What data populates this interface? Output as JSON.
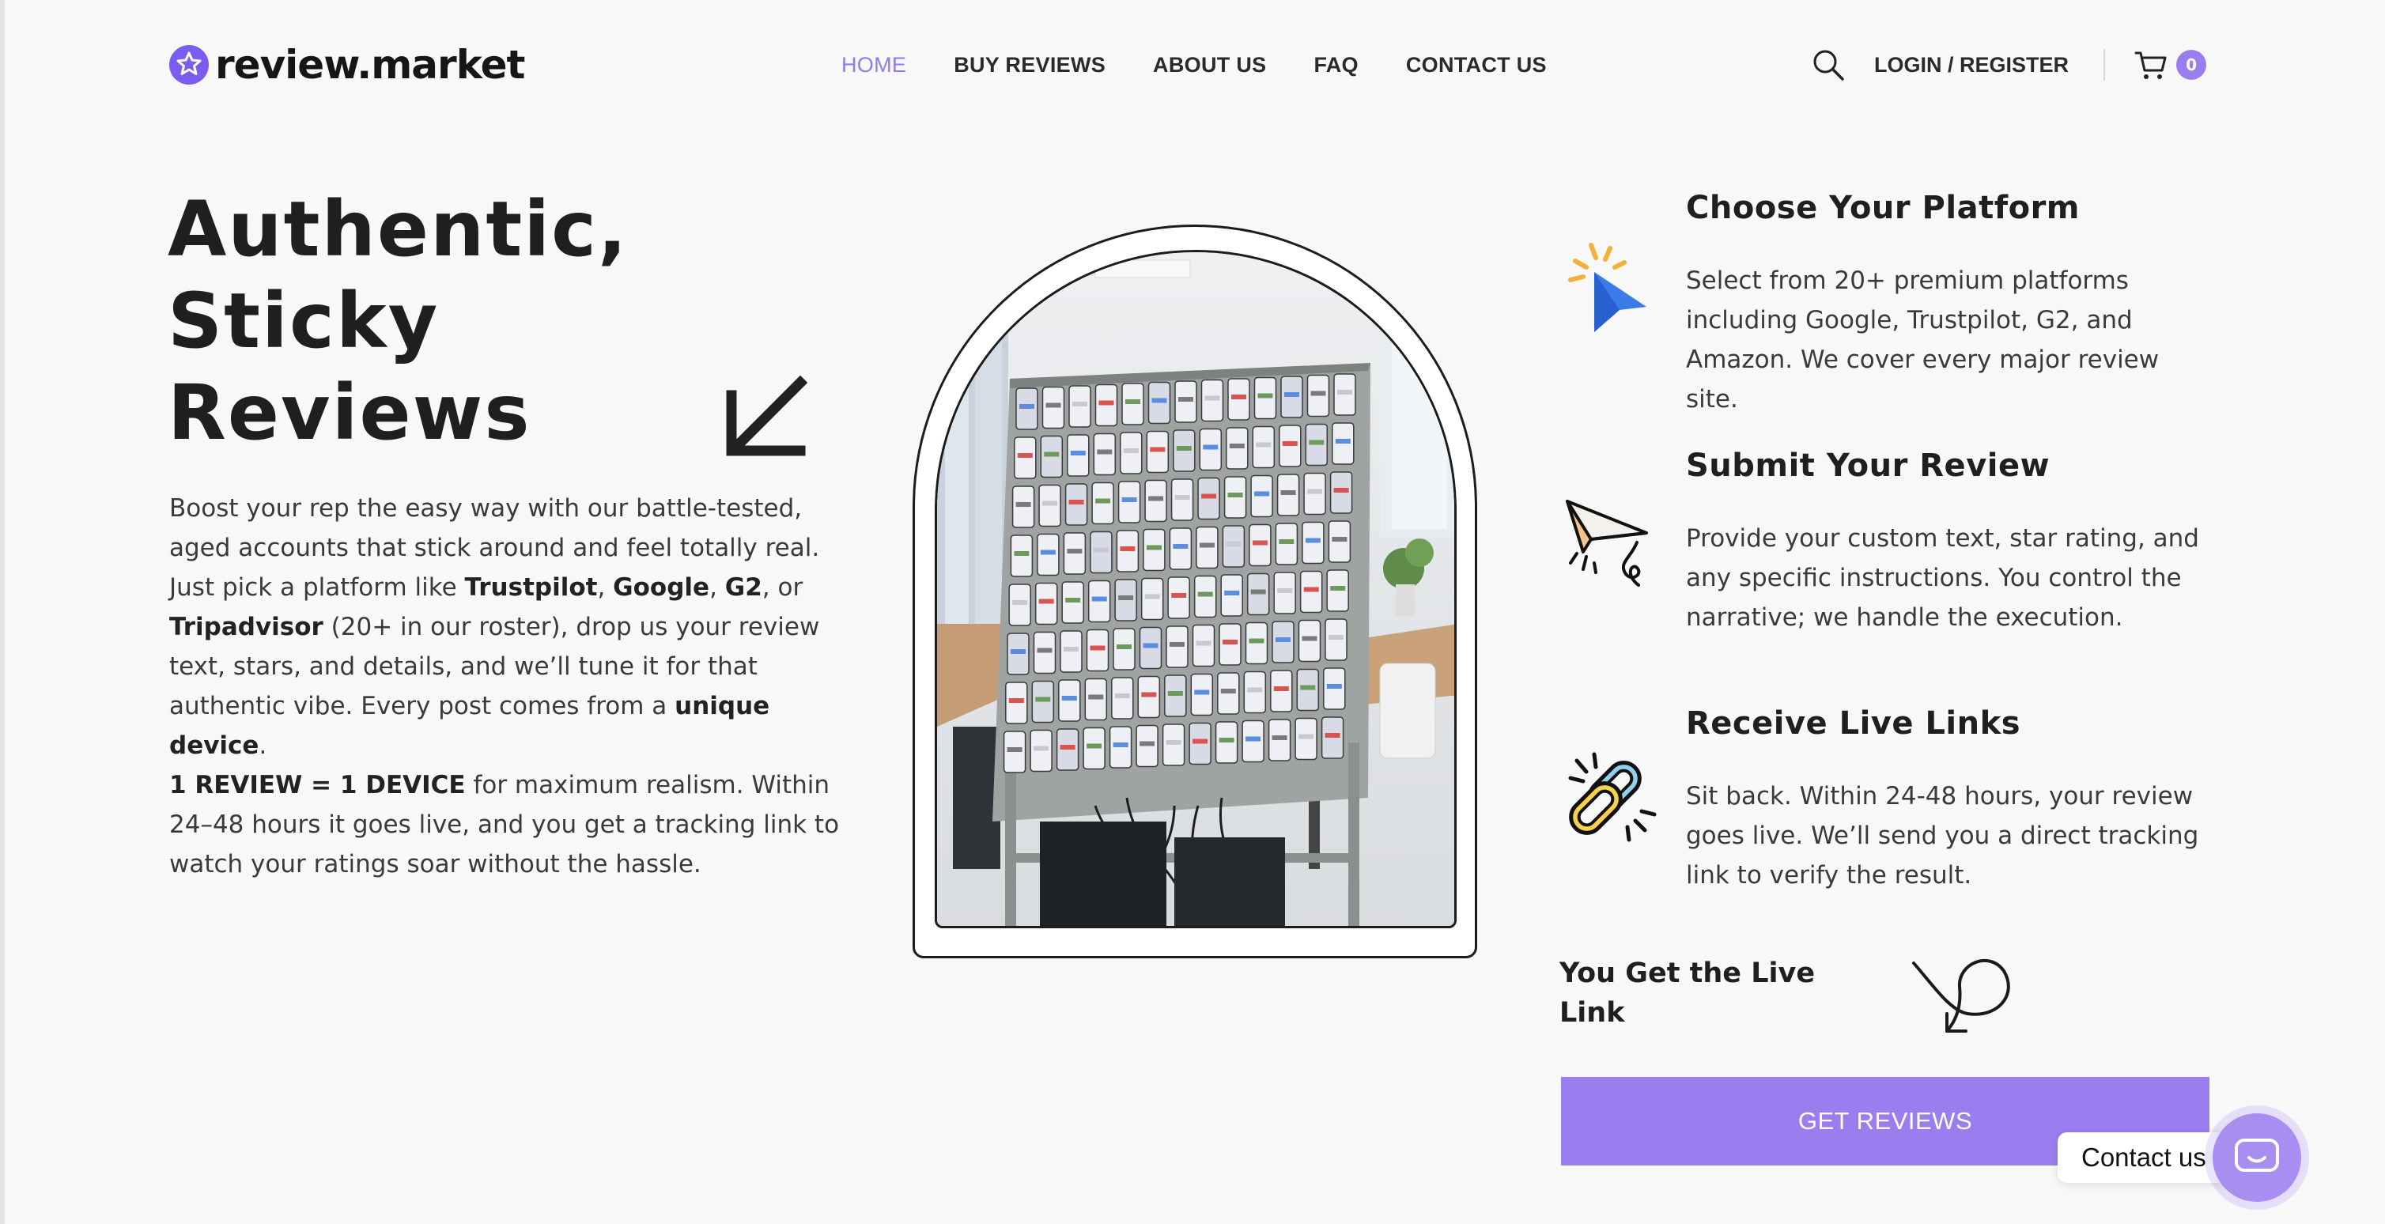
{
  "header": {
    "logo_text": "review.market",
    "nav": [
      "HOME",
      "BUY REVIEWS",
      "ABOUT US",
      "FAQ",
      "CONTACT US"
    ],
    "active_nav": "HOME",
    "login_label": "LOGIN / REGISTER",
    "cart_count": "0"
  },
  "hero": {
    "title_lines": [
      "Authentic,",
      "Sticky",
      "Reviews"
    ],
    "copy": {
      "p1_a": "Boost your rep the easy way with our battle-tested, aged accounts that stick around and feel totally real. Just pick a platform like ",
      "b_trustpilot": "Trustpilot",
      "sep1": ", ",
      "b_google": "Google",
      "sep2": ", ",
      "b_g2": "G2",
      "sep3": ", or ",
      "b_tripadvisor": "Tripadvisor",
      "p1_b": " (20+ in our roster), drop us your review text, stars, and details, and we’ll tune it for that authentic vibe. Every post comes from a ",
      "b_unique": "unique device",
      "p1_c": ".",
      "b_one_review": "1 REVIEW = 1 DEVICE",
      "p2": " for maximum realism. Within 24–48 hours it goes live, and you get a tracking link to watch your ratings soar without the hassle."
    }
  },
  "steps": [
    {
      "title": "Choose Your Platform",
      "text": "Select from 20+ premium platforms including Google, Trustpilot, G2, and Amazon. We cover every major review site.",
      "icon": "cursor-click-icon"
    },
    {
      "title": "Submit Your Review",
      "text": "Provide your custom text, star rating, and any specific instructions. You control the narrative; we handle the execution.",
      "icon": "paper-plane-icon"
    },
    {
      "title": "Receive Live Links",
      "text": "Sit back. Within 24-48 hours, your review goes live. We’ll send you a direct tracking link to verify the result.",
      "icon": "chain-link-icon"
    }
  ],
  "live_heading": "You Get the Live Link",
  "cta_label": "GET REVIEWS",
  "contact_label": "Contact us",
  "colors": {
    "accent": "#9a7ef0",
    "nav_active": "#9379ea",
    "background": "#f8f8f8",
    "text": "#222222"
  }
}
